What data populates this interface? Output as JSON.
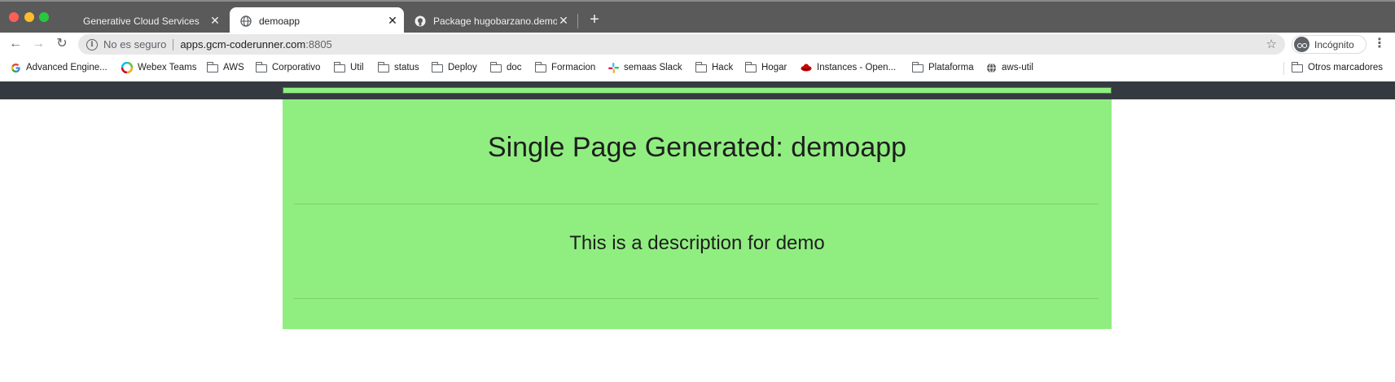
{
  "browser": {
    "tabs": [
      {
        "title": "Generative Cloud Services",
        "active": false
      },
      {
        "title": "demoapp",
        "active": true
      },
      {
        "title": "Package hugobarzano.demoapp",
        "active": false
      }
    ],
    "new_tab_symbol": "+",
    "address_bar": {
      "security_text": "No es seguro",
      "host": "apps.gcm-coderunner.com",
      "port": ":8805"
    },
    "profile_label": "Incógnito",
    "bookmarks": [
      {
        "label": "Advanced Engine...",
        "icon": "google-icon"
      },
      {
        "label": "Webex Teams",
        "icon": "webex-icon"
      },
      {
        "label": "AWS",
        "icon": "folder-icon"
      },
      {
        "label": "Corporativo",
        "icon": "folder-icon"
      },
      {
        "label": "Util",
        "icon": "folder-icon"
      },
      {
        "label": "status",
        "icon": "folder-icon"
      },
      {
        "label": "Deploy",
        "icon": "folder-icon"
      },
      {
        "label": "doc",
        "icon": "folder-icon"
      },
      {
        "label": "Formacion",
        "icon": "folder-icon"
      },
      {
        "label": "semaas Slack",
        "icon": "slack-icon"
      },
      {
        "label": "Hack",
        "icon": "folder-icon"
      },
      {
        "label": "Hogar",
        "icon": "folder-icon"
      },
      {
        "label": "Instances - Open...",
        "icon": "redhat-icon"
      },
      {
        "label": "Plataforma",
        "icon": "folder-icon"
      },
      {
        "label": "aws-util",
        "icon": "globe-icon"
      }
    ],
    "other_bookmarks": "Otros marcadores"
  },
  "page": {
    "title": "Single Page Generated: demoapp",
    "description": "This is a description for demo"
  },
  "colors": {
    "card_background": "#90ee80",
    "navbar_background": "#343a40",
    "tabstrip_background": "#5a5a5a"
  }
}
